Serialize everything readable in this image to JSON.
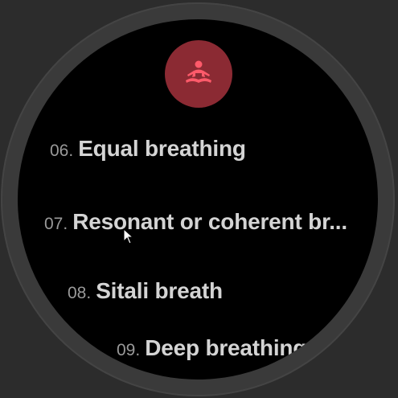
{
  "colors": {
    "background": "#2c2c2c",
    "bezel": "#3a3a3a",
    "screen": "#000000",
    "accent_circle": "#8b2a33",
    "accent_icon": "#ff5a6a",
    "number_text": "#9a9a9a",
    "title_text": "#d4d4d4"
  },
  "header": {
    "icon": "meditation-icon"
  },
  "list": {
    "items": [
      {
        "number": "06.",
        "title": "Equal breathing"
      },
      {
        "number": "07.",
        "title": "Resonant or coherent br..."
      },
      {
        "number": "08.",
        "title": "Sitali breath"
      },
      {
        "number": "09.",
        "title": "Deep breathing"
      }
    ]
  },
  "cursor": {
    "icon": "mouse-pointer-icon"
  }
}
